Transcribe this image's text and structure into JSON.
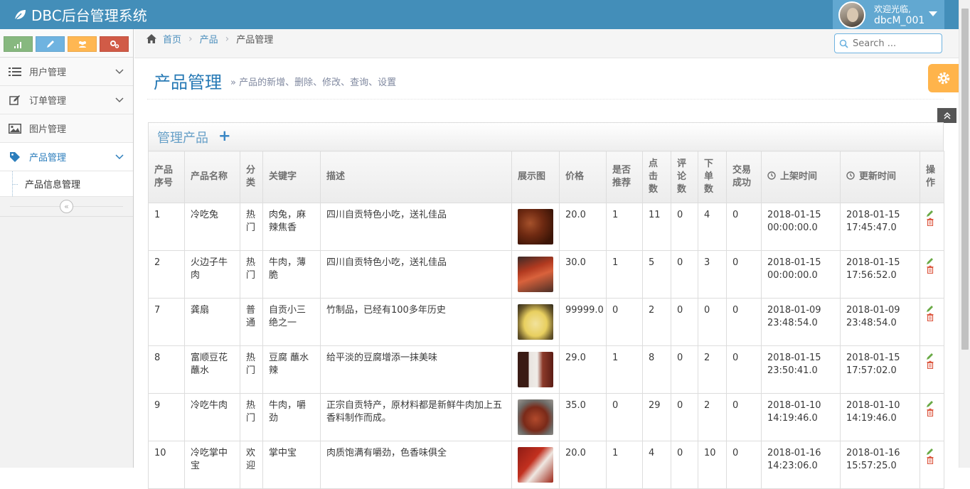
{
  "navbar": {
    "brand": "DBC后台管理系统",
    "welcome": "欢迎光临,",
    "username": "dbcM_001"
  },
  "shortcuts": [
    {
      "icon": "signal-icon",
      "color": "#87b87f"
    },
    {
      "icon": "pencil-icon",
      "color": "#6fb3e0"
    },
    {
      "icon": "group-icon",
      "color": "#ffb752"
    },
    {
      "icon": "cogs-icon",
      "color": "#d15b47"
    }
  ],
  "sidebar": {
    "items": [
      {
        "label": "用户管理",
        "icon": "list-icon"
      },
      {
        "label": "订单管理",
        "icon": "edit-icon"
      },
      {
        "label": "图片管理",
        "icon": "picture-icon"
      },
      {
        "label": "产品管理",
        "icon": "tag-icon"
      }
    ],
    "sub_item": "产品信息管理"
  },
  "breadcrumb": {
    "home": "首页",
    "level2": "产品",
    "current": "产品管理"
  },
  "search": {
    "placeholder": "Search ..."
  },
  "page": {
    "title": "产品管理",
    "description": "» 产品的新增、删除、修改、查询、设置"
  },
  "widget": {
    "title": "管理产品",
    "add": "+"
  },
  "table": {
    "headers": [
      "产品序号",
      "产品名称",
      "分类",
      "关键字",
      "描述",
      "展示图",
      "价格",
      "是否推荐",
      "点击数",
      "评论数",
      "下单数",
      "交易成功",
      "上架时间",
      "更新时间",
      "操作"
    ],
    "rows": [
      {
        "id": "1",
        "name": "冷吃兔",
        "category": "热门",
        "keywords": "肉兔，麻辣焦香",
        "desc": "四川自贡特色小吃，送礼佳品",
        "price": "20.0",
        "recommend": "1",
        "clicks": "11",
        "comments": "0",
        "orders": "4",
        "success": "0",
        "created": "2018-01-15 00:00:00.0",
        "updated": "2018-01-15 17:45:47.0"
      },
      {
        "id": "2",
        "name": "火边子牛肉",
        "category": "热门",
        "keywords": "牛肉，薄脆",
        "desc": "四川自贡特色小吃，送礼佳品",
        "price": "30.0",
        "recommend": "1",
        "clicks": "5",
        "comments": "0",
        "orders": "3",
        "success": "0",
        "created": "2018-01-15 00:00:00.0",
        "updated": "2018-01-15 17:56:52.0"
      },
      {
        "id": "7",
        "name": "龚扇",
        "category": "普通",
        "keywords": "自贡小三绝之一",
        "desc": "竹制品，已经有100多年历史",
        "price": "99999.0",
        "recommend": "0",
        "clicks": "2",
        "comments": "0",
        "orders": "0",
        "success": "0",
        "created": "2018-01-09 23:48:54.0",
        "updated": "2018-01-09 23:48:54.0"
      },
      {
        "id": "8",
        "name": "富顺豆花蘸水",
        "category": "热门",
        "keywords": "豆腐 蘸水辣",
        "desc": "给平淡的豆腐增添一抹美味",
        "price": "29.0",
        "recommend": "1",
        "clicks": "8",
        "comments": "0",
        "orders": "2",
        "success": "0",
        "created": "2018-01-15 23:50:41.0",
        "updated": "2018-01-15 17:57:02.0"
      },
      {
        "id": "9",
        "name": "冷吃牛肉",
        "category": "热门",
        "keywords": "牛肉，嚼劲",
        "desc": "正宗自贡特产，原材料都是新鲜牛肉加上五香料制作而成。",
        "price": "35.0",
        "recommend": "0",
        "clicks": "29",
        "comments": "0",
        "orders": "2",
        "success": "0",
        "created": "2018-01-10 14:19:46.0",
        "updated": "2018-01-10 14:19:46.0"
      },
      {
        "id": "10",
        "name": "冷吃掌中宝",
        "category": "欢迎",
        "keywords": "掌中宝",
        "desc": "肉质饱满有嚼劲，色香味俱全",
        "price": "20.0",
        "recommend": "1",
        "clicks": "4",
        "comments": "0",
        "orders": "10",
        "success": "0",
        "created": "2018-01-16 14:23:06.0",
        "updated": "2018-01-16 15:57:25.0"
      }
    ]
  },
  "colors": {
    "navbar": "#438eb9",
    "accent": "#2679b5",
    "edit": "#69aa46",
    "delete": "#dd5a43",
    "settings": "#ffb44b"
  }
}
